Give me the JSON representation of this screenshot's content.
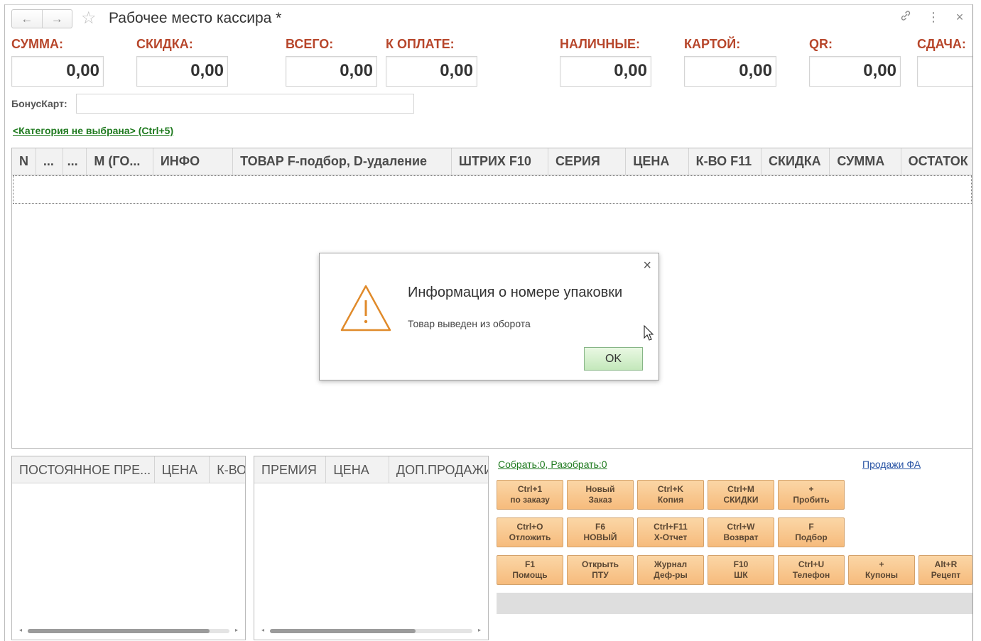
{
  "window": {
    "title": "Рабочее место кассира *",
    "nav_back": "←",
    "nav_forward": "→",
    "favorite_glyph": "☆",
    "link_glyph": "🔗",
    "menu_glyph": "⋮",
    "close_glyph": "×"
  },
  "totals": [
    {
      "label": "СУММА:",
      "value": "0,00"
    },
    {
      "label": "СКИДКА:",
      "value": "0,00"
    },
    {
      "label": "ВСЕГО:",
      "value": "0,00"
    },
    {
      "label": "К ОПЛАТЕ:",
      "value": "0,00"
    },
    {
      "label": "НАЛИЧНЫЕ:",
      "value": "0,00"
    },
    {
      "label": "КАРТОЙ:",
      "value": "0,00"
    },
    {
      "label": "QR:",
      "value": "0,00"
    },
    {
      "label": "СДАЧА:",
      "value": ""
    }
  ],
  "bonus": {
    "label": "БонусКарт:",
    "value": ""
  },
  "category_link": "<Категория не выбрана> (Ctrl+5)",
  "main_table": {
    "columns": [
      "N",
      "...",
      "...",
      "М (ГО...",
      "ИНФО",
      "ТОВАР  F-подбор, D-удаление",
      "ШТРИХ F10",
      "СЕРИЯ",
      "ЦЕНА",
      "К-ВО F11",
      "СКИДКА",
      "СУММА",
      "ОСТАТОК"
    ]
  },
  "dialog": {
    "title": "Информация о номере упаковки",
    "message": "Товар выведен из оборота",
    "ok_label": "OK",
    "close_glyph": "×",
    "icon": "warning-icon"
  },
  "panel_left": {
    "columns": [
      "ПОСТОЯННОЕ ПРЕ...",
      "ЦЕНА",
      "К-ВО"
    ]
  },
  "panel_mid": {
    "columns": [
      "ПРЕМИЯ",
      "ЦЕНА",
      "ДОП.ПРОДАЖИ"
    ]
  },
  "links": {
    "collect": "Собрать:0, Разобрать:0",
    "sales_fa": "Продажи ФА"
  },
  "function_buttons": [
    {
      "key": "Ctrl+1",
      "label": "по заказу"
    },
    {
      "key": "Новый",
      "label": "Заказ"
    },
    {
      "key": "Ctrl+K",
      "label": "Копия"
    },
    {
      "key": "Ctrl+M",
      "label": "СКИДКИ"
    },
    {
      "key": "+",
      "label": "Пробить"
    },
    {
      "key": "Ctrl+O",
      "label": "Отложить"
    },
    {
      "key": "F6",
      "label": "НОВЫЙ"
    },
    {
      "key": "Ctrl+F11",
      "label": "Х-Отчет"
    },
    {
      "key": "Ctrl+W",
      "label": "Возврат"
    },
    {
      "key": "F",
      "label": "Подбор"
    },
    {
      "key": "F1",
      "label": "Помощь"
    },
    {
      "key": "Открыть",
      "label": "ПТУ"
    },
    {
      "key": "Журнал",
      "label": "Деф-ры"
    },
    {
      "key": "F10",
      "label": "ШК"
    },
    {
      "key": "Ctrl+U",
      "label": "Телефон"
    },
    {
      "key": "+",
      "label": "Купоны"
    },
    {
      "key": "Alt+R",
      "label": "Рецепт"
    }
  ],
  "colors": {
    "label_accent": "#b7462b",
    "button_orange": "#f6bb7c",
    "ok_green": "#c4e8bb",
    "link_green": "#1f7a1f",
    "link_blue": "#2a55a5"
  }
}
